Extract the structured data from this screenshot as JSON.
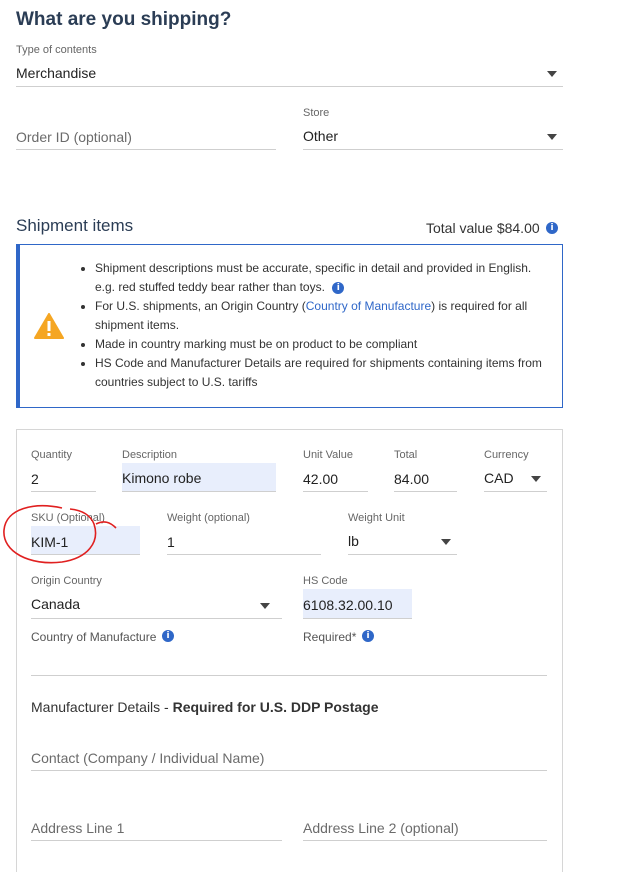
{
  "header": {
    "title": "What are you shipping?"
  },
  "contents": {
    "label": "Type of contents",
    "value": "Merchandise"
  },
  "order": {
    "placeholder": "Order ID (optional)",
    "store_label": "Store",
    "store_value": "Other"
  },
  "shipment": {
    "title": "Shipment items",
    "total_label": "Total value $84.00"
  },
  "notice": {
    "line1": "Shipment descriptions must be accurate, specific in detail and provided in English.",
    "line1b": "e.g. red stuffed teddy bear rather than toys.",
    "line2_pre": "For U.S. shipments, an Origin Country (",
    "line2_link": "Country of Manufacture",
    "line2_post": ") is required for all",
    "line2b": "shipment items.",
    "line3": "Made in country marking must be on product to be compliant",
    "line4": "HS Code and Manufacturer Details are required for shipments containing items from",
    "line4b": "countries subject to U.S. tariffs"
  },
  "item": {
    "quantity_label": "Quantity",
    "quantity": "2",
    "description_label": "Description",
    "description": "Kimono robe",
    "unit_value_label": "Unit Value",
    "unit_value": "42.00",
    "total_label": "Total",
    "total": "84.00",
    "currency_label": "Currency",
    "currency": "CAD",
    "sku_label": "SKU (Optional)",
    "sku": "KIM-1",
    "weight_label": "Weight (optional)",
    "weight": "1",
    "weight_unit_label": "Weight Unit",
    "weight_unit": "lb",
    "origin_label": "Origin Country",
    "origin": "Canada",
    "hs_label": "HS Code",
    "hs": "6108.32.00.10",
    "com_label": "Country of Manufacture",
    "required_label": "Required*"
  },
  "manufacturer": {
    "title_pre": "Manufacturer Details - ",
    "title_bold": "Required for U.S. DDP Postage",
    "contact_placeholder": "Contact (Company / Individual Name)",
    "address1_placeholder": "Address Line 1",
    "address2_placeholder": "Address Line 2 (optional)"
  },
  "colors": {
    "accent": "#2f67c8",
    "warning": "#f5a623",
    "annotation": "#e02020"
  }
}
